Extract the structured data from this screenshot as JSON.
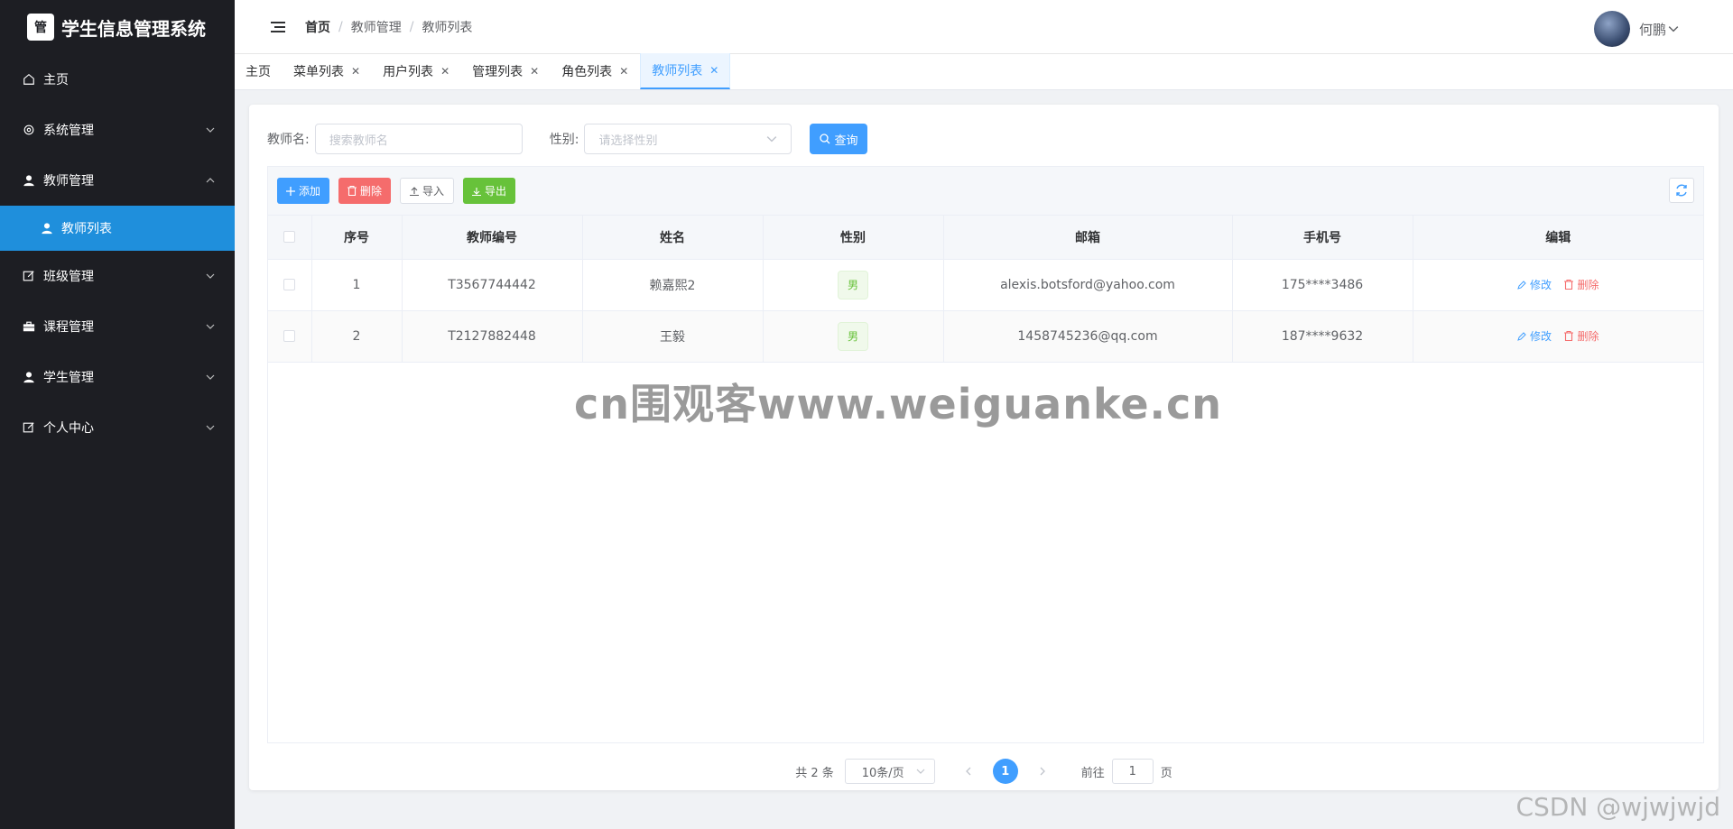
{
  "app": {
    "title": "学生信息管理系统",
    "logo_text": "管"
  },
  "sidebar": {
    "items": [
      {
        "label": "主页",
        "icon": "home-icon"
      },
      {
        "label": "系统管理",
        "icon": "gear-icon"
      },
      {
        "label": "教师管理",
        "icon": "user-icon"
      },
      {
        "label": "教师列表",
        "icon": "user-icon"
      },
      {
        "label": "班级管理",
        "icon": "edit-icon"
      },
      {
        "label": "课程管理",
        "icon": "briefcase-icon"
      },
      {
        "label": "学生管理",
        "icon": "user-icon"
      },
      {
        "label": "个人中心",
        "icon": "edit-icon"
      }
    ]
  },
  "header": {
    "breadcrumb": [
      "首页",
      "教师管理",
      "教师列表"
    ],
    "username": "何鹏"
  },
  "tabs": [
    {
      "label": "主页"
    },
    {
      "label": "菜单列表"
    },
    {
      "label": "用户列表"
    },
    {
      "label": "管理列表"
    },
    {
      "label": "角色列表"
    },
    {
      "label": "教师列表"
    }
  ],
  "search": {
    "name_label": "教师名:",
    "name_placeholder": "搜索教师名",
    "gender_label": "性别:",
    "gender_placeholder": "请选择性别",
    "query_label": "查询"
  },
  "toolbar": {
    "add_label": "添加",
    "delete_label": "删除",
    "import_label": "导入",
    "export_label": "导出"
  },
  "table": {
    "columns": [
      "序号",
      "教师编号",
      "姓名",
      "性别",
      "邮箱",
      "手机号",
      "编辑"
    ],
    "rows": [
      {
        "index": "1",
        "code": "T3567744442",
        "name": "赖嘉熙2",
        "gender": "男",
        "email": "alexis.botsford@yahoo.com",
        "phone": "175****3486"
      },
      {
        "index": "2",
        "code": "T2127882448",
        "name": "王毅",
        "gender": "男",
        "email": "1458745236@qq.com",
        "phone": "187****9632"
      }
    ],
    "edit_label": "修改",
    "delete_label": "删除"
  },
  "pagination": {
    "total": "共 2 条",
    "page_size": "10条/页",
    "current_page": "1",
    "goto_label": "前往",
    "goto_value": "1",
    "page_suffix": "页"
  },
  "watermarks": {
    "center": "cn围观客www.weiguanke.cn",
    "corner": "CSDN @wjwjwjd"
  },
  "colors": {
    "sidebar_bg": "#1d1e23",
    "sidebar_active": "#1f8fdc",
    "primary": "#409eff",
    "danger": "#f56c6c",
    "success": "#67c23a"
  }
}
